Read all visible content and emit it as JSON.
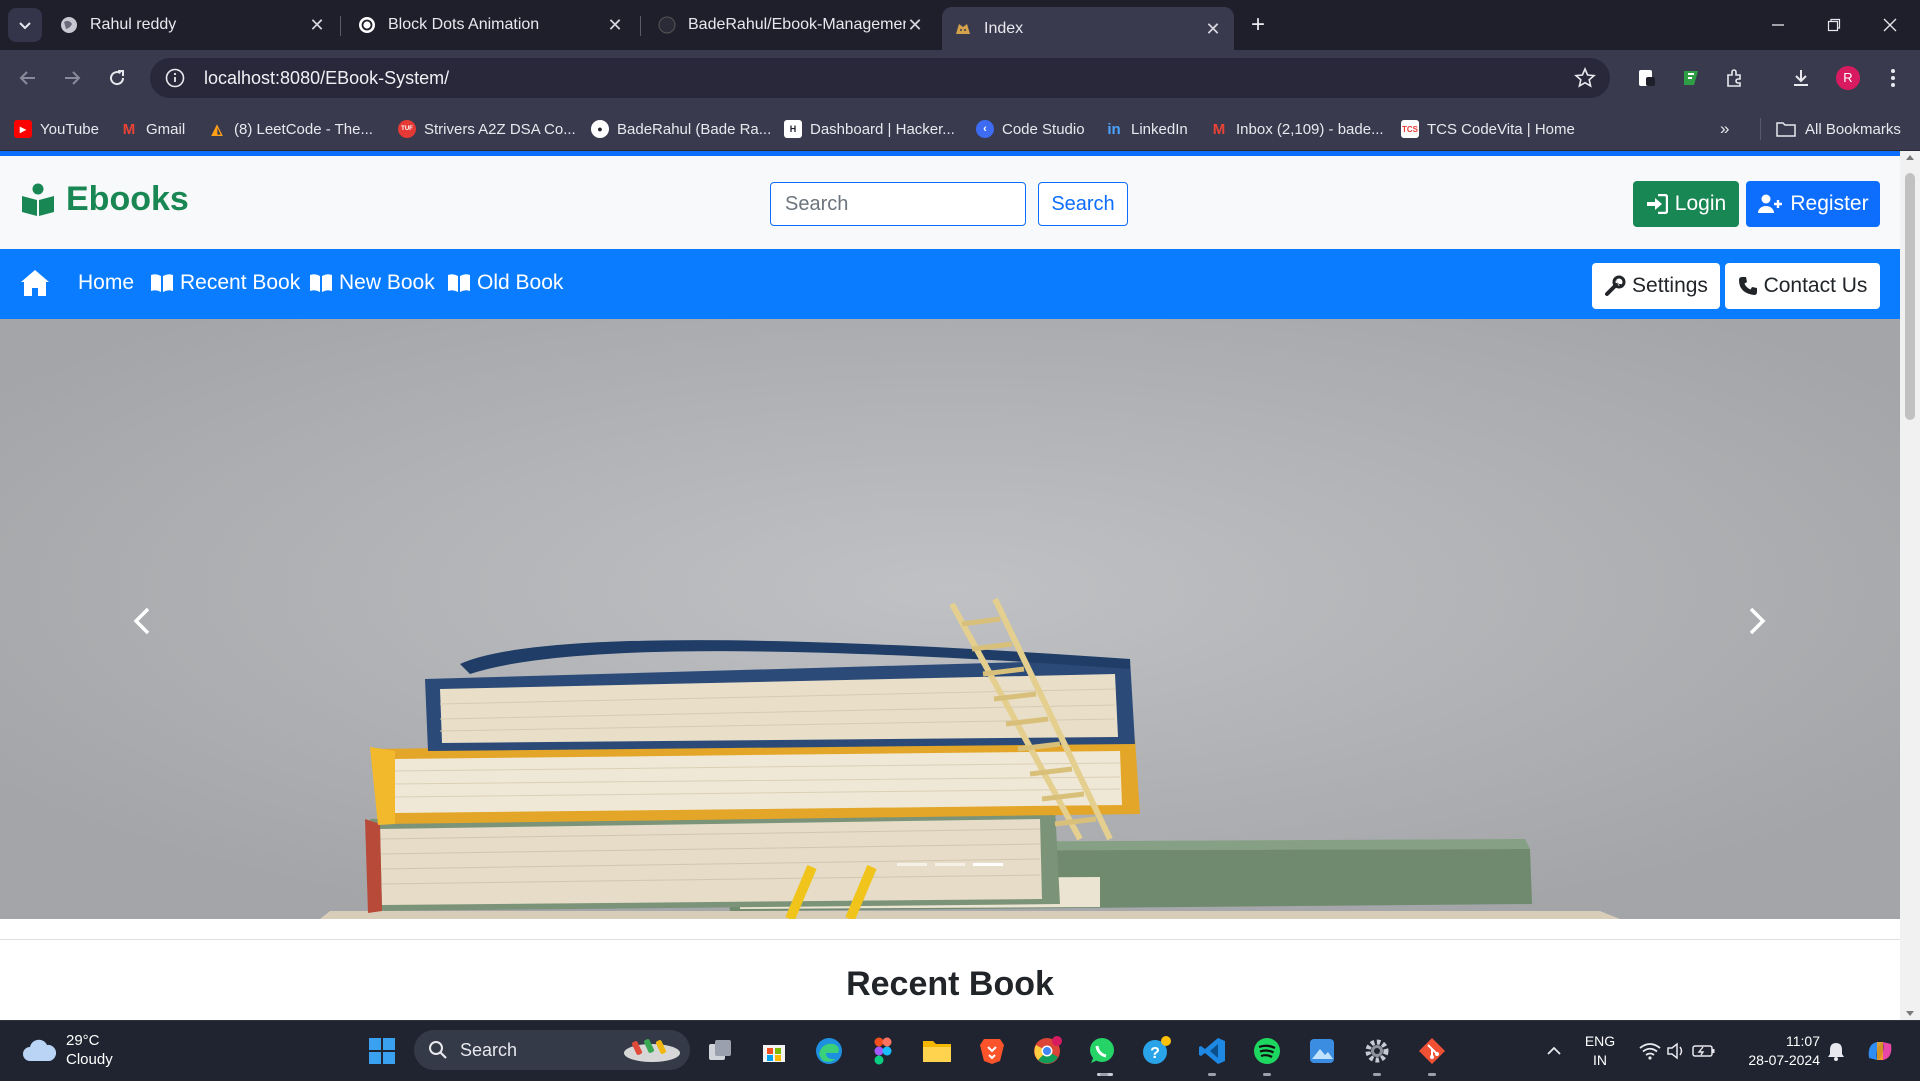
{
  "browser": {
    "tabs": [
      {
        "title": "Rahul reddy",
        "icon": "globe-icon"
      },
      {
        "title": "Block Dots Animation",
        "icon": "openai-icon"
      },
      {
        "title": "BadeRahul/Ebook-Managemen",
        "icon": "github-icon"
      },
      {
        "title": "Index",
        "icon": "tomcat-icon",
        "active": true
      }
    ],
    "url": "localhost:8080/EBook-System/",
    "profile_initial": "R",
    "bookmarks": [
      {
        "label": "YouTube",
        "icon": "youtube-icon",
        "color": "#ff0000"
      },
      {
        "label": "Gmail",
        "icon": "gmail-icon",
        "color": "#ea4335"
      },
      {
        "label": "(8) LeetCode - The...",
        "icon": "leetcode-icon",
        "color": "#ffa116"
      },
      {
        "label": "Strivers A2Z DSA Co...",
        "icon": "tuf-icon",
        "color": "#e53935"
      },
      {
        "label": "BadeRahul (Bade Ra...",
        "icon": "github-icon",
        "color": "#ffffff"
      },
      {
        "label": "Dashboard | Hacker...",
        "icon": "hackerrank-icon",
        "color": "#00ea64"
      },
      {
        "label": "Code Studio",
        "icon": "codestudio-icon",
        "color": "#3d6cf2"
      },
      {
        "label": "LinkedIn",
        "icon": "linkedin-icon",
        "color": "#0a66c2"
      },
      {
        "label": "Inbox (2,109) - bade...",
        "icon": "gmail-icon",
        "color": "#ea4335"
      },
      {
        "label": "TCS CodeVita | Home",
        "icon": "tcs-icon",
        "color": "#e53935"
      }
    ],
    "all_bookmarks_label": "All Bookmarks"
  },
  "site": {
    "brand": "Ebooks",
    "brand_color": "#198754",
    "search_placeholder": "Search",
    "search_button": "Search",
    "login_label": "Login",
    "register_label": "Register",
    "nav": {
      "home": "Home",
      "recent": "Recent Book",
      "new": "New Book",
      "old": "Old Book",
      "settings": "Settings",
      "contact": "Contact Us"
    },
    "carousel": {
      "slide_count": 3,
      "active_index": 2
    },
    "section_title": "Recent Book",
    "primary_color": "#0d6efd",
    "nav_color": "#0a7cff"
  },
  "taskbar": {
    "temperature": "29°C",
    "condition": "Cloudy",
    "search_label": "Search",
    "lang_top": "ENG",
    "lang_bottom": "IN",
    "time": "11:07",
    "date": "28-07-2024",
    "apps": [
      "windows-start-icon",
      "file-explorer-icon",
      "microsoft-store-icon",
      "edge-icon",
      "figma-icon",
      "folder-icon",
      "brave-icon",
      "chrome-icon",
      "whatsapp-icon",
      "help-icon",
      "vscode-icon",
      "spotify-icon",
      "photos-icon",
      "settings-icon",
      "git-icon"
    ]
  }
}
